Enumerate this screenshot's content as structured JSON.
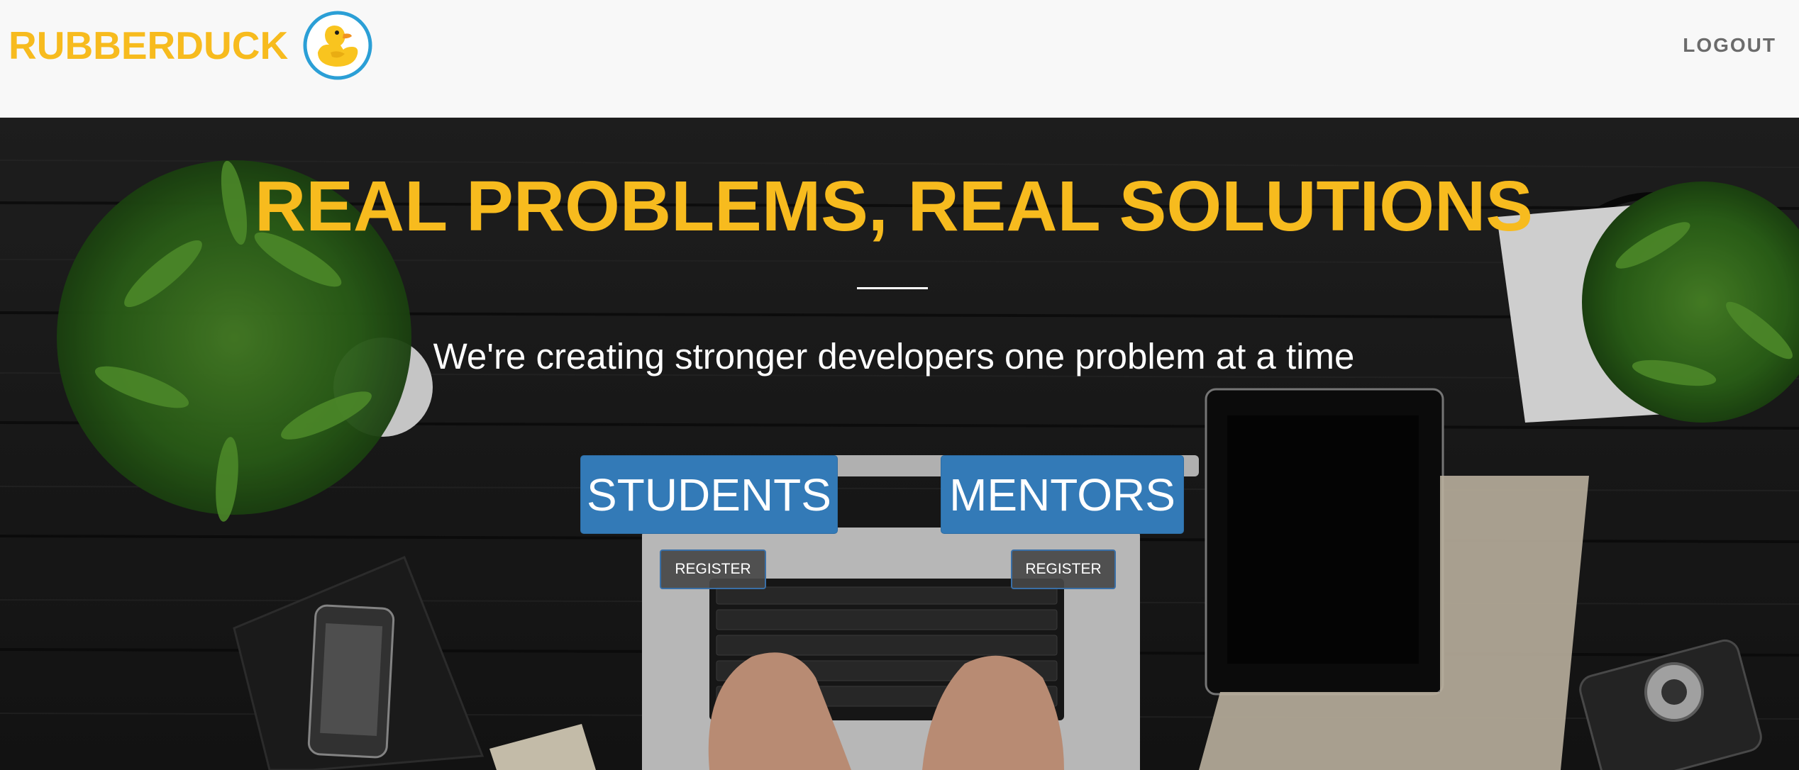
{
  "brand": {
    "name": "RUBBERDUCK",
    "logo_icon": "rubber-duck-icon",
    "color": "#f7bb1e"
  },
  "nav": {
    "logout_label": "LOGOUT"
  },
  "hero": {
    "title": "REAL PROBLEMS, REAL SOLUTIONS",
    "subtitle": "We're creating stronger developers one problem at a time",
    "background": "desk-workspace-photo",
    "cards": [
      {
        "id": "students",
        "title": "STUDENTS",
        "register_label": "REGISTER"
      },
      {
        "id": "mentors",
        "title": "MENTORS",
        "register_label": "REGISTER"
      }
    ]
  },
  "colors": {
    "accent": "#f7bb1e",
    "primary_button": "#337ab7",
    "navbar_bg": "#f8f8f8",
    "logo_ring": "#2b9fd6"
  }
}
